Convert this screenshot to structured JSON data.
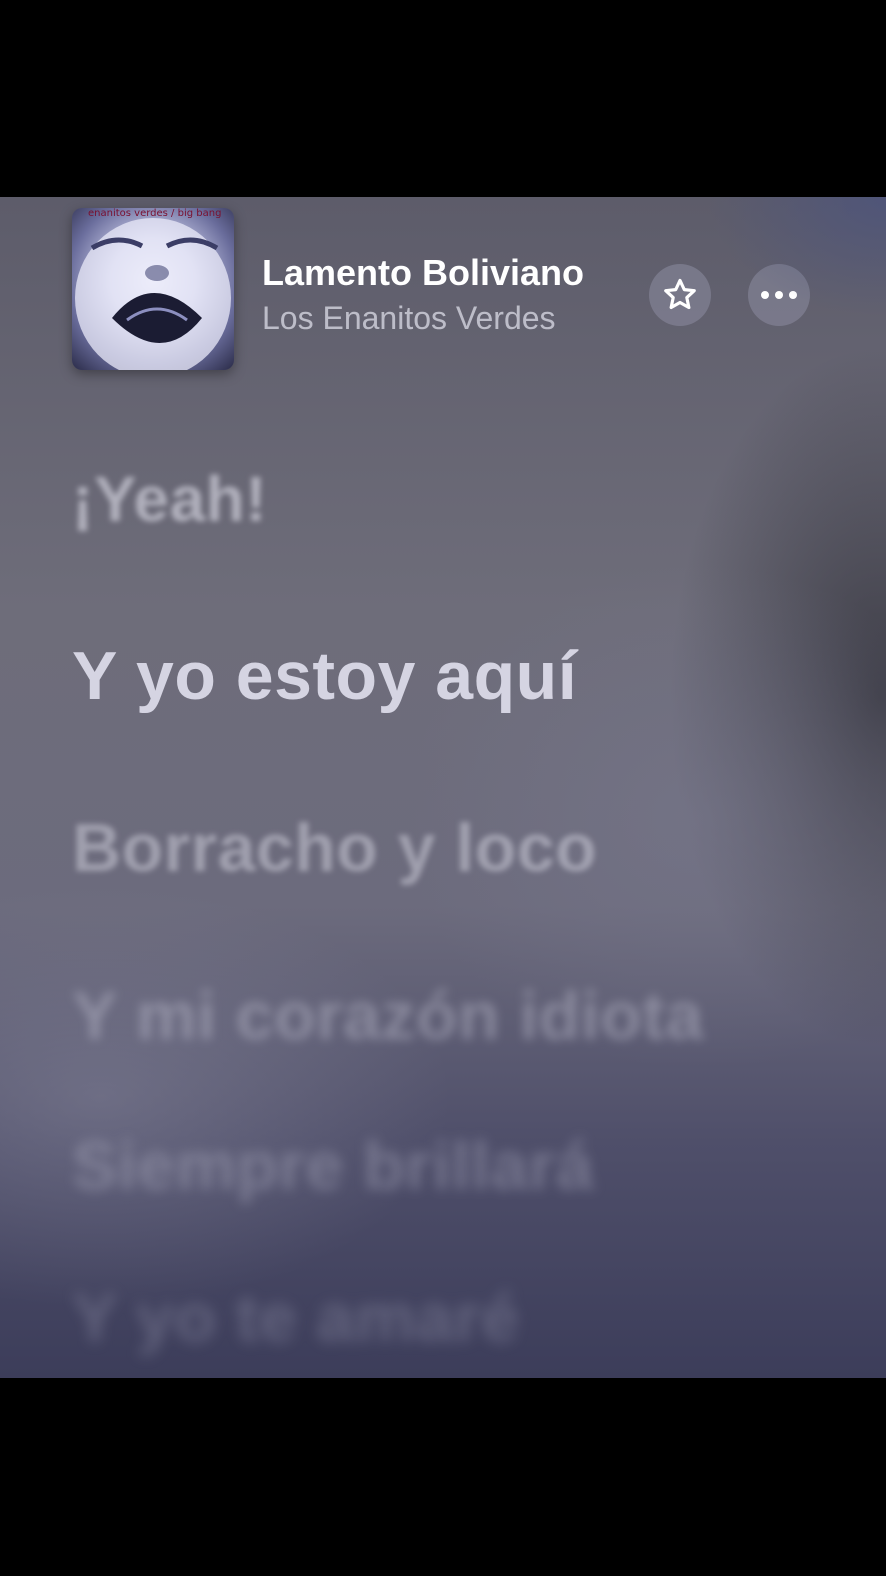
{
  "now_playing": {
    "album_art_caption": "enanitos verdes / big bang",
    "title": "Lamento Boliviano",
    "artist": "Los Enanitos Verdes",
    "favorite_icon": "star-icon",
    "more_icon": "ellipsis-icon"
  },
  "lyrics": {
    "lines": [
      "¡Yeah!",
      "Y yo estoy aquí",
      "Borracho y loco",
      "Y mi corazón idiota",
      "Siempre brillará",
      "Y yo te amaré"
    ],
    "current_index": 1
  }
}
